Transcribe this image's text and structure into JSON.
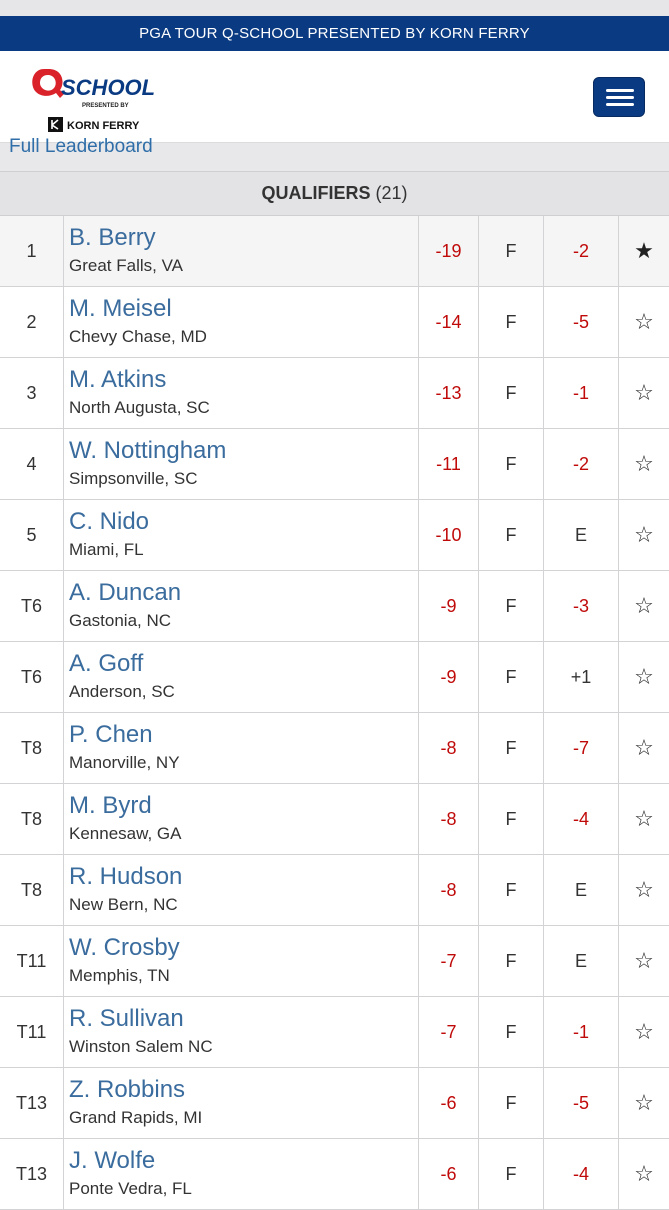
{
  "banner": {
    "text": "PGA TOUR Q-SCHOOL PRESENTED BY KORN FERRY"
  },
  "logo": {
    "q": "Q",
    "school": "SCHOOL",
    "presented": "PRESENTED BY",
    "sponsor": "KORN FERRY",
    "brand_red": "#d9222a",
    "brand_navy": "#0a3a82"
  },
  "nav": {
    "full_leaderboard": "Full Leaderboard"
  },
  "section": {
    "title": "QUALIFIERS",
    "count": "(21)"
  },
  "colors": {
    "under_par": "#c00a0a",
    "name_link": "#3a6c9e",
    "header_blue": "#0a3a82"
  },
  "players": [
    {
      "pos": "1",
      "name": "B. Berry",
      "loc": "Great Falls, VA",
      "total": "-19",
      "thru": "F",
      "today": "-2",
      "fav": true
    },
    {
      "pos": "2",
      "name": "M. Meisel",
      "loc": "Chevy Chase, MD",
      "total": "-14",
      "thru": "F",
      "today": "-5",
      "fav": false
    },
    {
      "pos": "3",
      "name": "M. Atkins",
      "loc": "North Augusta, SC",
      "total": "-13",
      "thru": "F",
      "today": "-1",
      "fav": false
    },
    {
      "pos": "4",
      "name": "W. Nottingham",
      "loc": "Simpsonville, SC",
      "total": "-11",
      "thru": "F",
      "today": "-2",
      "fav": false
    },
    {
      "pos": "5",
      "name": "C. Nido",
      "loc": "Miami, FL",
      "total": "-10",
      "thru": "F",
      "today": "E",
      "fav": false
    },
    {
      "pos": "T6",
      "name": "A. Duncan",
      "loc": "Gastonia, NC",
      "total": "-9",
      "thru": "F",
      "today": "-3",
      "fav": false
    },
    {
      "pos": "T6",
      "name": "A. Goff",
      "loc": "Anderson, SC",
      "total": "-9",
      "thru": "F",
      "today": "+1",
      "fav": false
    },
    {
      "pos": "T8",
      "name": "P. Chen",
      "loc": "Manorville, NY",
      "total": "-8",
      "thru": "F",
      "today": "-7",
      "fav": false
    },
    {
      "pos": "T8",
      "name": "M. Byrd",
      "loc": "Kennesaw, GA",
      "total": "-8",
      "thru": "F",
      "today": "-4",
      "fav": false
    },
    {
      "pos": "T8",
      "name": "R. Hudson",
      "loc": "New Bern, NC",
      "total": "-8",
      "thru": "F",
      "today": "E",
      "fav": false
    },
    {
      "pos": "T11",
      "name": "W. Crosby",
      "loc": "Memphis, TN",
      "total": "-7",
      "thru": "F",
      "today": "E",
      "fav": false
    },
    {
      "pos": "T11",
      "name": "R. Sullivan",
      "loc": "Winston Salem NC",
      "total": "-7",
      "thru": "F",
      "today": "-1",
      "fav": false
    },
    {
      "pos": "T13",
      "name": "Z. Robbins",
      "loc": "Grand Rapids, MI",
      "total": "-6",
      "thru": "F",
      "today": "-5",
      "fav": false
    },
    {
      "pos": "T13",
      "name": "J. Wolfe",
      "loc": "Ponte Vedra, FL",
      "total": "-6",
      "thru": "F",
      "today": "-4",
      "fav": false
    }
  ]
}
